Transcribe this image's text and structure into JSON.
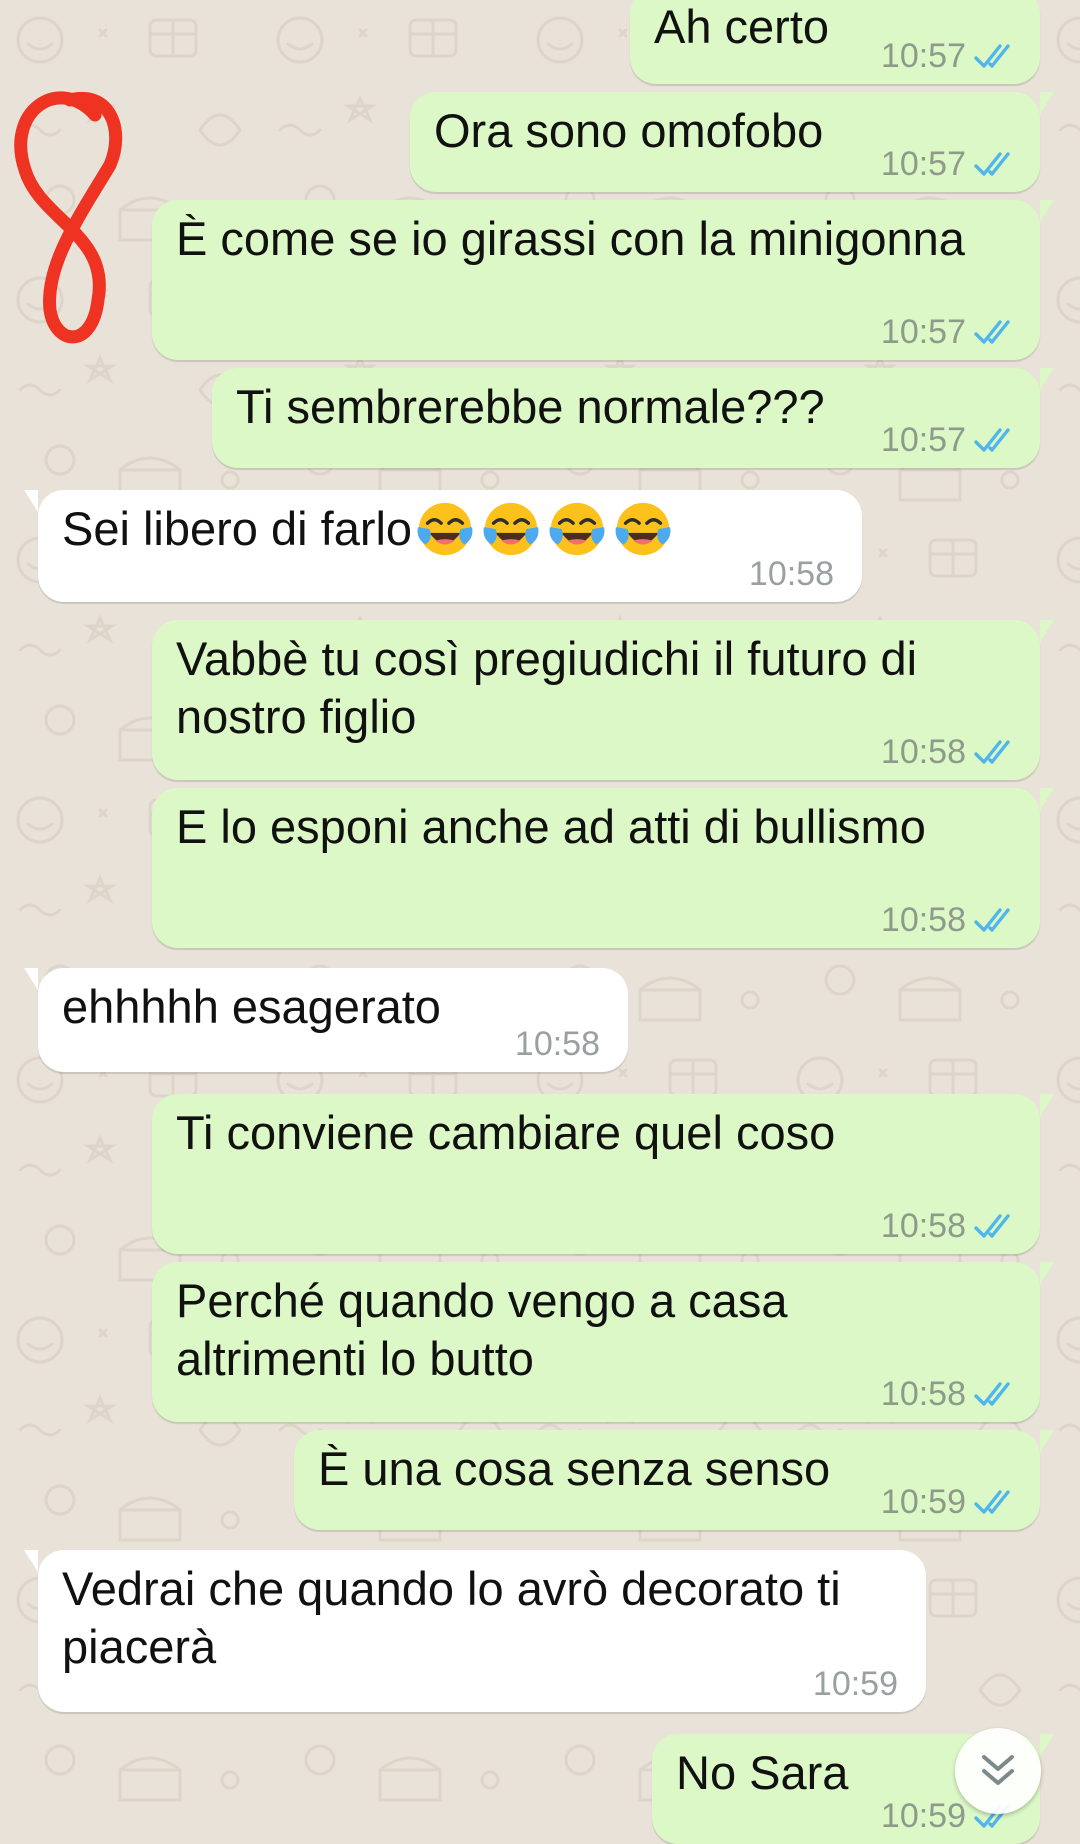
{
  "messages": [
    {
      "id": "m1",
      "direction": "outgoing",
      "lines": [
        "Ah certo"
      ],
      "time": "10:57",
      "status": "read"
    },
    {
      "id": "m2",
      "direction": "outgoing",
      "lines": [
        "Ora sono omofobo"
      ],
      "time": "10:57",
      "status": "read"
    },
    {
      "id": "m3",
      "direction": "outgoing",
      "lines": [
        "È come se io girassi con la minigonna"
      ],
      "time": "10:57",
      "status": "read"
    },
    {
      "id": "m4",
      "direction": "outgoing",
      "lines": [
        "Ti sembrerebbe normale???"
      ],
      "time": "10:57",
      "status": "read"
    },
    {
      "id": "m5",
      "direction": "incoming",
      "lines": [
        "Sei libero di farlo"
      ],
      "emoji": "face-with-tears-of-joy",
      "emoji_count": 4,
      "time": "10:58"
    },
    {
      "id": "m6",
      "direction": "outgoing",
      "lines": [
        "Vabbè tu così pregiudichi il futuro di",
        "nostro figlio"
      ],
      "time": "10:58",
      "status": "read"
    },
    {
      "id": "m7",
      "direction": "outgoing",
      "lines": [
        "E lo esponi anche ad atti di bullismo"
      ],
      "time": "10:58",
      "status": "read"
    },
    {
      "id": "m8",
      "direction": "incoming",
      "lines": [
        "ehhhhh esagerato"
      ],
      "time": "10:58"
    },
    {
      "id": "m9",
      "direction": "outgoing",
      "lines": [
        "Ti conviene cambiare quel coso"
      ],
      "time": "10:58",
      "status": "read"
    },
    {
      "id": "m10",
      "direction": "outgoing",
      "lines": [
        "Perché quando vengo a casa",
        "altrimenti lo butto"
      ],
      "time": "10:58",
      "status": "read"
    },
    {
      "id": "m11",
      "direction": "outgoing",
      "lines": [
        "È una cosa senza senso"
      ],
      "time": "10:59",
      "status": "read"
    },
    {
      "id": "m12",
      "direction": "incoming",
      "lines": [
        "Vedrai che quando lo avrò decorato ti",
        "piacerà"
      ],
      "time": "10:59"
    },
    {
      "id": "m13",
      "direction": "outgoing",
      "lines": [
        "No Sara"
      ],
      "time": "10:59",
      "status": "read"
    }
  ],
  "colors": {
    "outgoing_bubble": "#dcf8c6",
    "incoming_bubble": "#ffffff",
    "wallpaper": "#e9e2d8",
    "read_ticks": "#4fb6ec",
    "annotation": "#ee3322"
  },
  "overlays": {
    "annotation_mark": "handwritten-loop-scribble",
    "scroll_button_icon": "double-chevron-down-icon"
  }
}
